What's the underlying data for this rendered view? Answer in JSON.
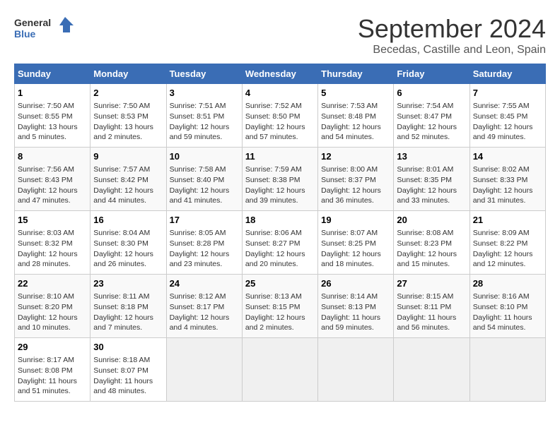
{
  "logo": {
    "line1": "General",
    "line2": "Blue"
  },
  "title": "September 2024",
  "subtitle": "Becedas, Castille and Leon, Spain",
  "weekdays": [
    "Sunday",
    "Monday",
    "Tuesday",
    "Wednesday",
    "Thursday",
    "Friday",
    "Saturday"
  ],
  "weeks": [
    [
      {
        "day": "1",
        "info": "Sunrise: 7:50 AM\nSunset: 8:55 PM\nDaylight: 13 hours and 5 minutes."
      },
      {
        "day": "2",
        "info": "Sunrise: 7:50 AM\nSunset: 8:53 PM\nDaylight: 13 hours and 2 minutes."
      },
      {
        "day": "3",
        "info": "Sunrise: 7:51 AM\nSunset: 8:51 PM\nDaylight: 12 hours and 59 minutes."
      },
      {
        "day": "4",
        "info": "Sunrise: 7:52 AM\nSunset: 8:50 PM\nDaylight: 12 hours and 57 minutes."
      },
      {
        "day": "5",
        "info": "Sunrise: 7:53 AM\nSunset: 8:48 PM\nDaylight: 12 hours and 54 minutes."
      },
      {
        "day": "6",
        "info": "Sunrise: 7:54 AM\nSunset: 8:47 PM\nDaylight: 12 hours and 52 minutes."
      },
      {
        "day": "7",
        "info": "Sunrise: 7:55 AM\nSunset: 8:45 PM\nDaylight: 12 hours and 49 minutes."
      }
    ],
    [
      {
        "day": "8",
        "info": "Sunrise: 7:56 AM\nSunset: 8:43 PM\nDaylight: 12 hours and 47 minutes."
      },
      {
        "day": "9",
        "info": "Sunrise: 7:57 AM\nSunset: 8:42 PM\nDaylight: 12 hours and 44 minutes."
      },
      {
        "day": "10",
        "info": "Sunrise: 7:58 AM\nSunset: 8:40 PM\nDaylight: 12 hours and 41 minutes."
      },
      {
        "day": "11",
        "info": "Sunrise: 7:59 AM\nSunset: 8:38 PM\nDaylight: 12 hours and 39 minutes."
      },
      {
        "day": "12",
        "info": "Sunrise: 8:00 AM\nSunset: 8:37 PM\nDaylight: 12 hours and 36 minutes."
      },
      {
        "day": "13",
        "info": "Sunrise: 8:01 AM\nSunset: 8:35 PM\nDaylight: 12 hours and 33 minutes."
      },
      {
        "day": "14",
        "info": "Sunrise: 8:02 AM\nSunset: 8:33 PM\nDaylight: 12 hours and 31 minutes."
      }
    ],
    [
      {
        "day": "15",
        "info": "Sunrise: 8:03 AM\nSunset: 8:32 PM\nDaylight: 12 hours and 28 minutes."
      },
      {
        "day": "16",
        "info": "Sunrise: 8:04 AM\nSunset: 8:30 PM\nDaylight: 12 hours and 26 minutes."
      },
      {
        "day": "17",
        "info": "Sunrise: 8:05 AM\nSunset: 8:28 PM\nDaylight: 12 hours and 23 minutes."
      },
      {
        "day": "18",
        "info": "Sunrise: 8:06 AM\nSunset: 8:27 PM\nDaylight: 12 hours and 20 minutes."
      },
      {
        "day": "19",
        "info": "Sunrise: 8:07 AM\nSunset: 8:25 PM\nDaylight: 12 hours and 18 minutes."
      },
      {
        "day": "20",
        "info": "Sunrise: 8:08 AM\nSunset: 8:23 PM\nDaylight: 12 hours and 15 minutes."
      },
      {
        "day": "21",
        "info": "Sunrise: 8:09 AM\nSunset: 8:22 PM\nDaylight: 12 hours and 12 minutes."
      }
    ],
    [
      {
        "day": "22",
        "info": "Sunrise: 8:10 AM\nSunset: 8:20 PM\nDaylight: 12 hours and 10 minutes."
      },
      {
        "day": "23",
        "info": "Sunrise: 8:11 AM\nSunset: 8:18 PM\nDaylight: 12 hours and 7 minutes."
      },
      {
        "day": "24",
        "info": "Sunrise: 8:12 AM\nSunset: 8:17 PM\nDaylight: 12 hours and 4 minutes."
      },
      {
        "day": "25",
        "info": "Sunrise: 8:13 AM\nSunset: 8:15 PM\nDaylight: 12 hours and 2 minutes."
      },
      {
        "day": "26",
        "info": "Sunrise: 8:14 AM\nSunset: 8:13 PM\nDaylight: 11 hours and 59 minutes."
      },
      {
        "day": "27",
        "info": "Sunrise: 8:15 AM\nSunset: 8:11 PM\nDaylight: 11 hours and 56 minutes."
      },
      {
        "day": "28",
        "info": "Sunrise: 8:16 AM\nSunset: 8:10 PM\nDaylight: 11 hours and 54 minutes."
      }
    ],
    [
      {
        "day": "29",
        "info": "Sunrise: 8:17 AM\nSunset: 8:08 PM\nDaylight: 11 hours and 51 minutes."
      },
      {
        "day": "30",
        "info": "Sunrise: 8:18 AM\nSunset: 8:07 PM\nDaylight: 11 hours and 48 minutes."
      },
      null,
      null,
      null,
      null,
      null
    ]
  ]
}
